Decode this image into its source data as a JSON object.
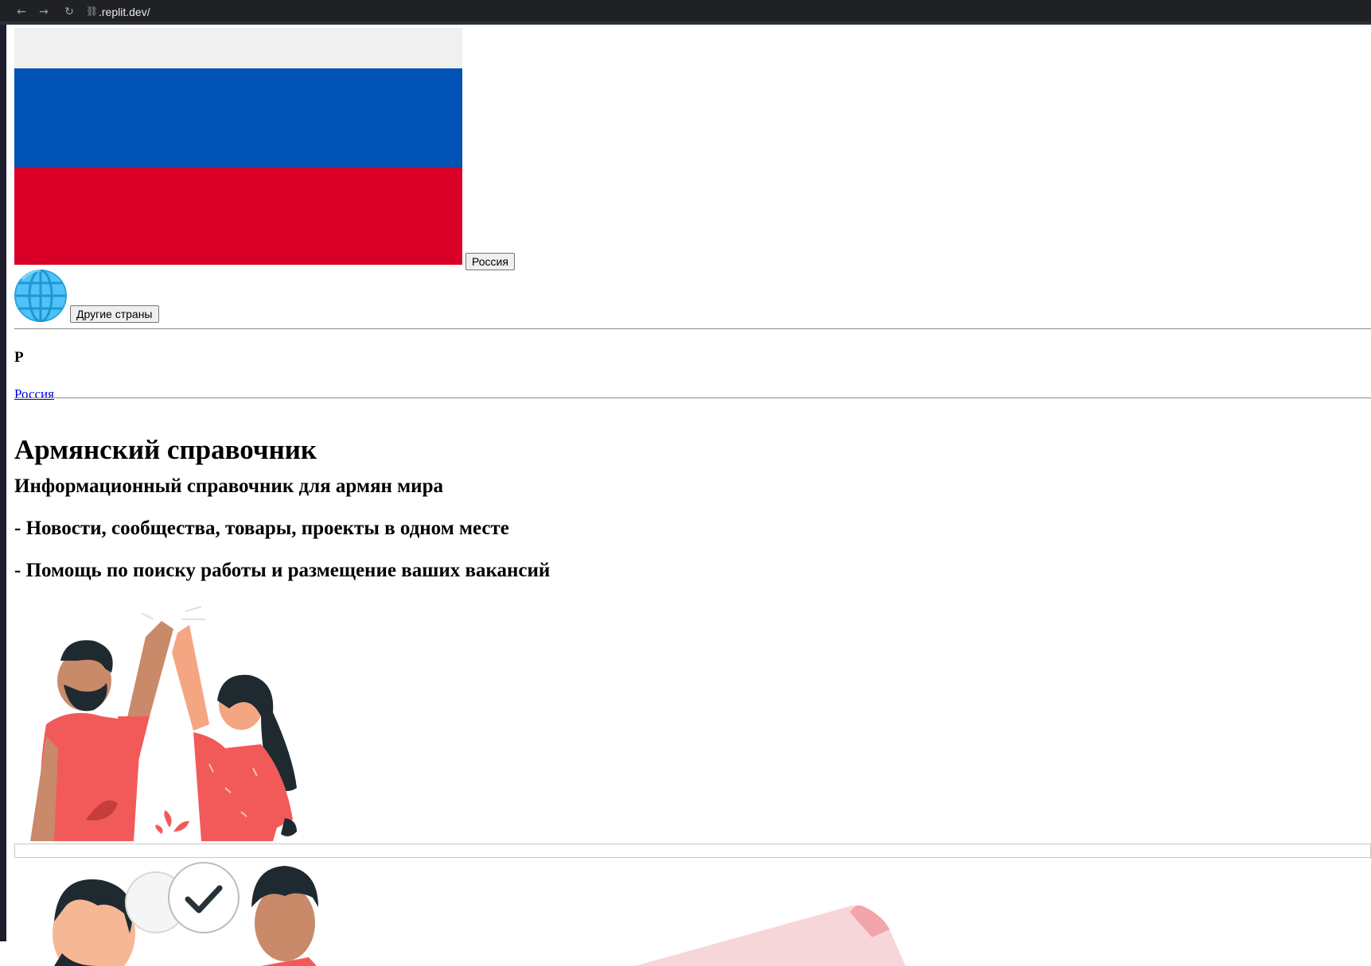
{
  "browser": {
    "url": ".replit.dev/",
    "back_icon": "arrow-left-icon",
    "forward_icon": "arrow-right-icon",
    "reload_icon": "reload-icon",
    "url_icon": "link-icon"
  },
  "country": {
    "flag_colors": [
      "#f0f0f0",
      "#0052b4",
      "#d80027"
    ],
    "button_label": "Россия"
  },
  "other": {
    "icon": "globe-icon",
    "button_label": "Другие страны"
  },
  "index": {
    "letter": "Р",
    "link": "Россия"
  },
  "hero": {
    "title": "Армянский справочник",
    "lines": [
      "Информационный справочник для армян мира",
      "- Новости, сообщества, товары, проекты в одном месте",
      "- Помощь по поиску работы и размещение ваших вакансий"
    ]
  },
  "illustrations": [
    "high-five-illustration",
    "chat-check-illustration"
  ]
}
